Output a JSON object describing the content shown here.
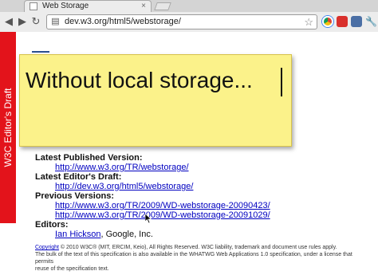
{
  "browser": {
    "tab_title": "Web Storage",
    "tab_close": "×",
    "url": "dev.w3.org/html5/webstorage/",
    "back": "◀",
    "forward": "▶",
    "reload": "↻",
    "star": "☆",
    "extension_icons": [
      "chrome-icon",
      "stop-icon",
      "camera-icon",
      "wrench-icon"
    ]
  },
  "ribbon": {
    "label": "W3C Editor's Draft",
    "color": "#e3131b"
  },
  "sticky_note": {
    "text": "Without local storage..."
  },
  "doc": {
    "latest_published_label": "Latest Published Version:",
    "latest_published_url": "http://www.w3.org/TR/webstorage/",
    "latest_editors_label": "Latest Editor's Draft:",
    "latest_editors_url": "http://dev.w3.org/html5/webstorage/",
    "previous_label": "Previous Versions:",
    "previous_urls": [
      "http://www.w3.org/TR/2009/WD-webstorage-20090423/",
      "http://www.w3.org/TR/2009/WD-webstorage-20091029/"
    ],
    "editors_label": "Editors:",
    "editor_name": "Ian Hickson",
    "editor_affiliation": ", Google, Inc."
  },
  "copyright": {
    "line1_prefix": "Copyright",
    "line1_rest": " © 2010 W3C",
    "line1_orgs": "® (MIT, ERCIM, Keio), All Rights Reserved. W3C liability, trademark and document use rules apply.",
    "line2": "The bulk of the text of this specification is also available in the WHATWG Web Applications 1.0 specification, under a license that permits",
    "line3": "reuse of the specification text."
  }
}
